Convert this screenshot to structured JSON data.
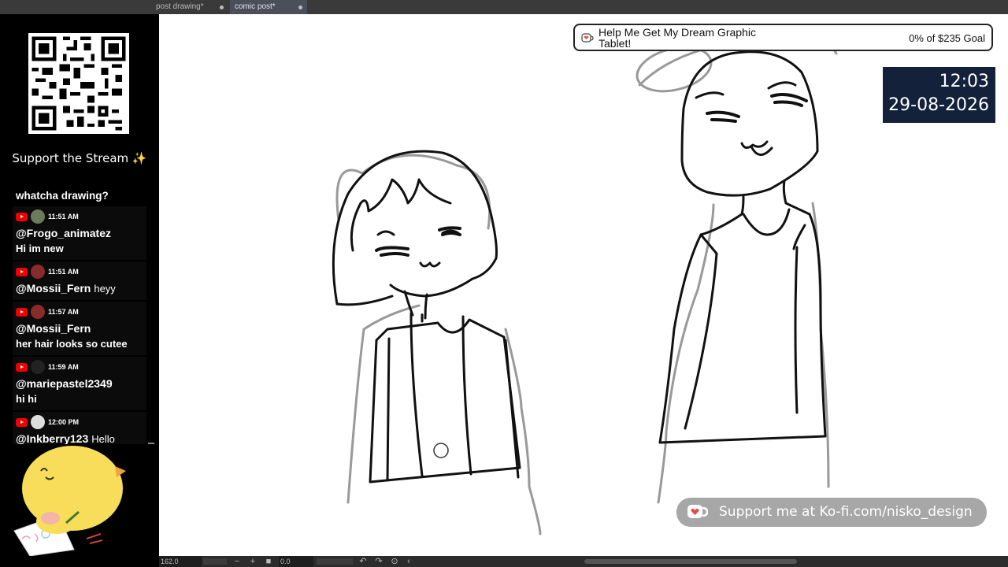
{
  "tabs": [
    {
      "label": "post drawing*"
    },
    {
      "label": "comic post*"
    }
  ],
  "sidebar": {
    "support_title": "Support the Stream ✨",
    "chat_first_line": "whatcha drawing?",
    "messages": [
      {
        "time": "11:51 AM",
        "user": "@Frogo_animatez",
        "text": "Hi im new",
        "inline": false
      },
      {
        "time": "11:51 AM",
        "user": "@Mossii_Fern",
        "text": "heyy",
        "inline": true
      },
      {
        "time": "11:57 AM",
        "user": "@Mossii_Fern",
        "text": "her hair looks so cutee",
        "inline": false
      },
      {
        "time": "11:59 AM",
        "user": "@mariepastel2349",
        "text": "hi hi",
        "inline": false
      },
      {
        "time": "12:00 PM",
        "user": "@Inkberry123",
        "text": "Hello",
        "inline": true
      }
    ]
  },
  "goal": {
    "title": "Help Me Get My Dream Graphic Tablet!",
    "progress": "0% of $235 Goal"
  },
  "clock": {
    "time": "12:03",
    "date": "29-08-2026"
  },
  "kofi": {
    "text": "Support me at Ko-fi.com/nisko_design"
  },
  "statusbar": {
    "zoom": "162.0",
    "rotation": "0.0"
  },
  "colors": {
    "canvas": "#ffffff",
    "clock_bg": "#13213a",
    "kofi_bg": "#a7a7a7",
    "youtube_red": "#ee0000"
  }
}
